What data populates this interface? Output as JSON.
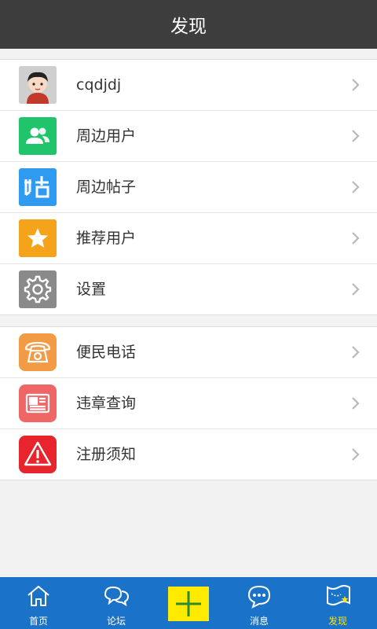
{
  "header": {
    "title": "发现"
  },
  "group1": [
    {
      "label": "cqdjdj",
      "icon": "user-avatar-icon",
      "color": "#c9c9c9"
    },
    {
      "label": "周边用户",
      "icon": "people-icon",
      "color": "#1fc46b"
    },
    {
      "label": "周边帖子",
      "icon": "post-icon",
      "color": "#2e9bf0"
    },
    {
      "label": "推荐用户",
      "icon": "star-icon",
      "color": "#f5a31a"
    },
    {
      "label": "设置",
      "icon": "gear-icon",
      "color": "#8a8a8a"
    }
  ],
  "group2": [
    {
      "label": "便民电话",
      "icon": "telephone-icon",
      "color": "#f39a44"
    },
    {
      "label": "违章查询",
      "icon": "newspaper-icon",
      "color": "#f06565"
    },
    {
      "label": "注册须知",
      "icon": "warning-icon",
      "color": "#e8242d"
    }
  ],
  "tabs": [
    {
      "label": "首页",
      "icon": "home-icon"
    },
    {
      "label": "论坛",
      "icon": "chat-bubbles-icon"
    },
    {
      "label": "",
      "icon": "plus-icon"
    },
    {
      "label": "消息",
      "icon": "message-icon"
    },
    {
      "label": "发现",
      "icon": "map-flag-icon",
      "active": true
    }
  ],
  "colors": {
    "header_bg": "#3d3d3d",
    "tabbar_bg": "#1a73c8",
    "active_tab": "#ffe400",
    "plus_bg": "#ffeb00"
  }
}
